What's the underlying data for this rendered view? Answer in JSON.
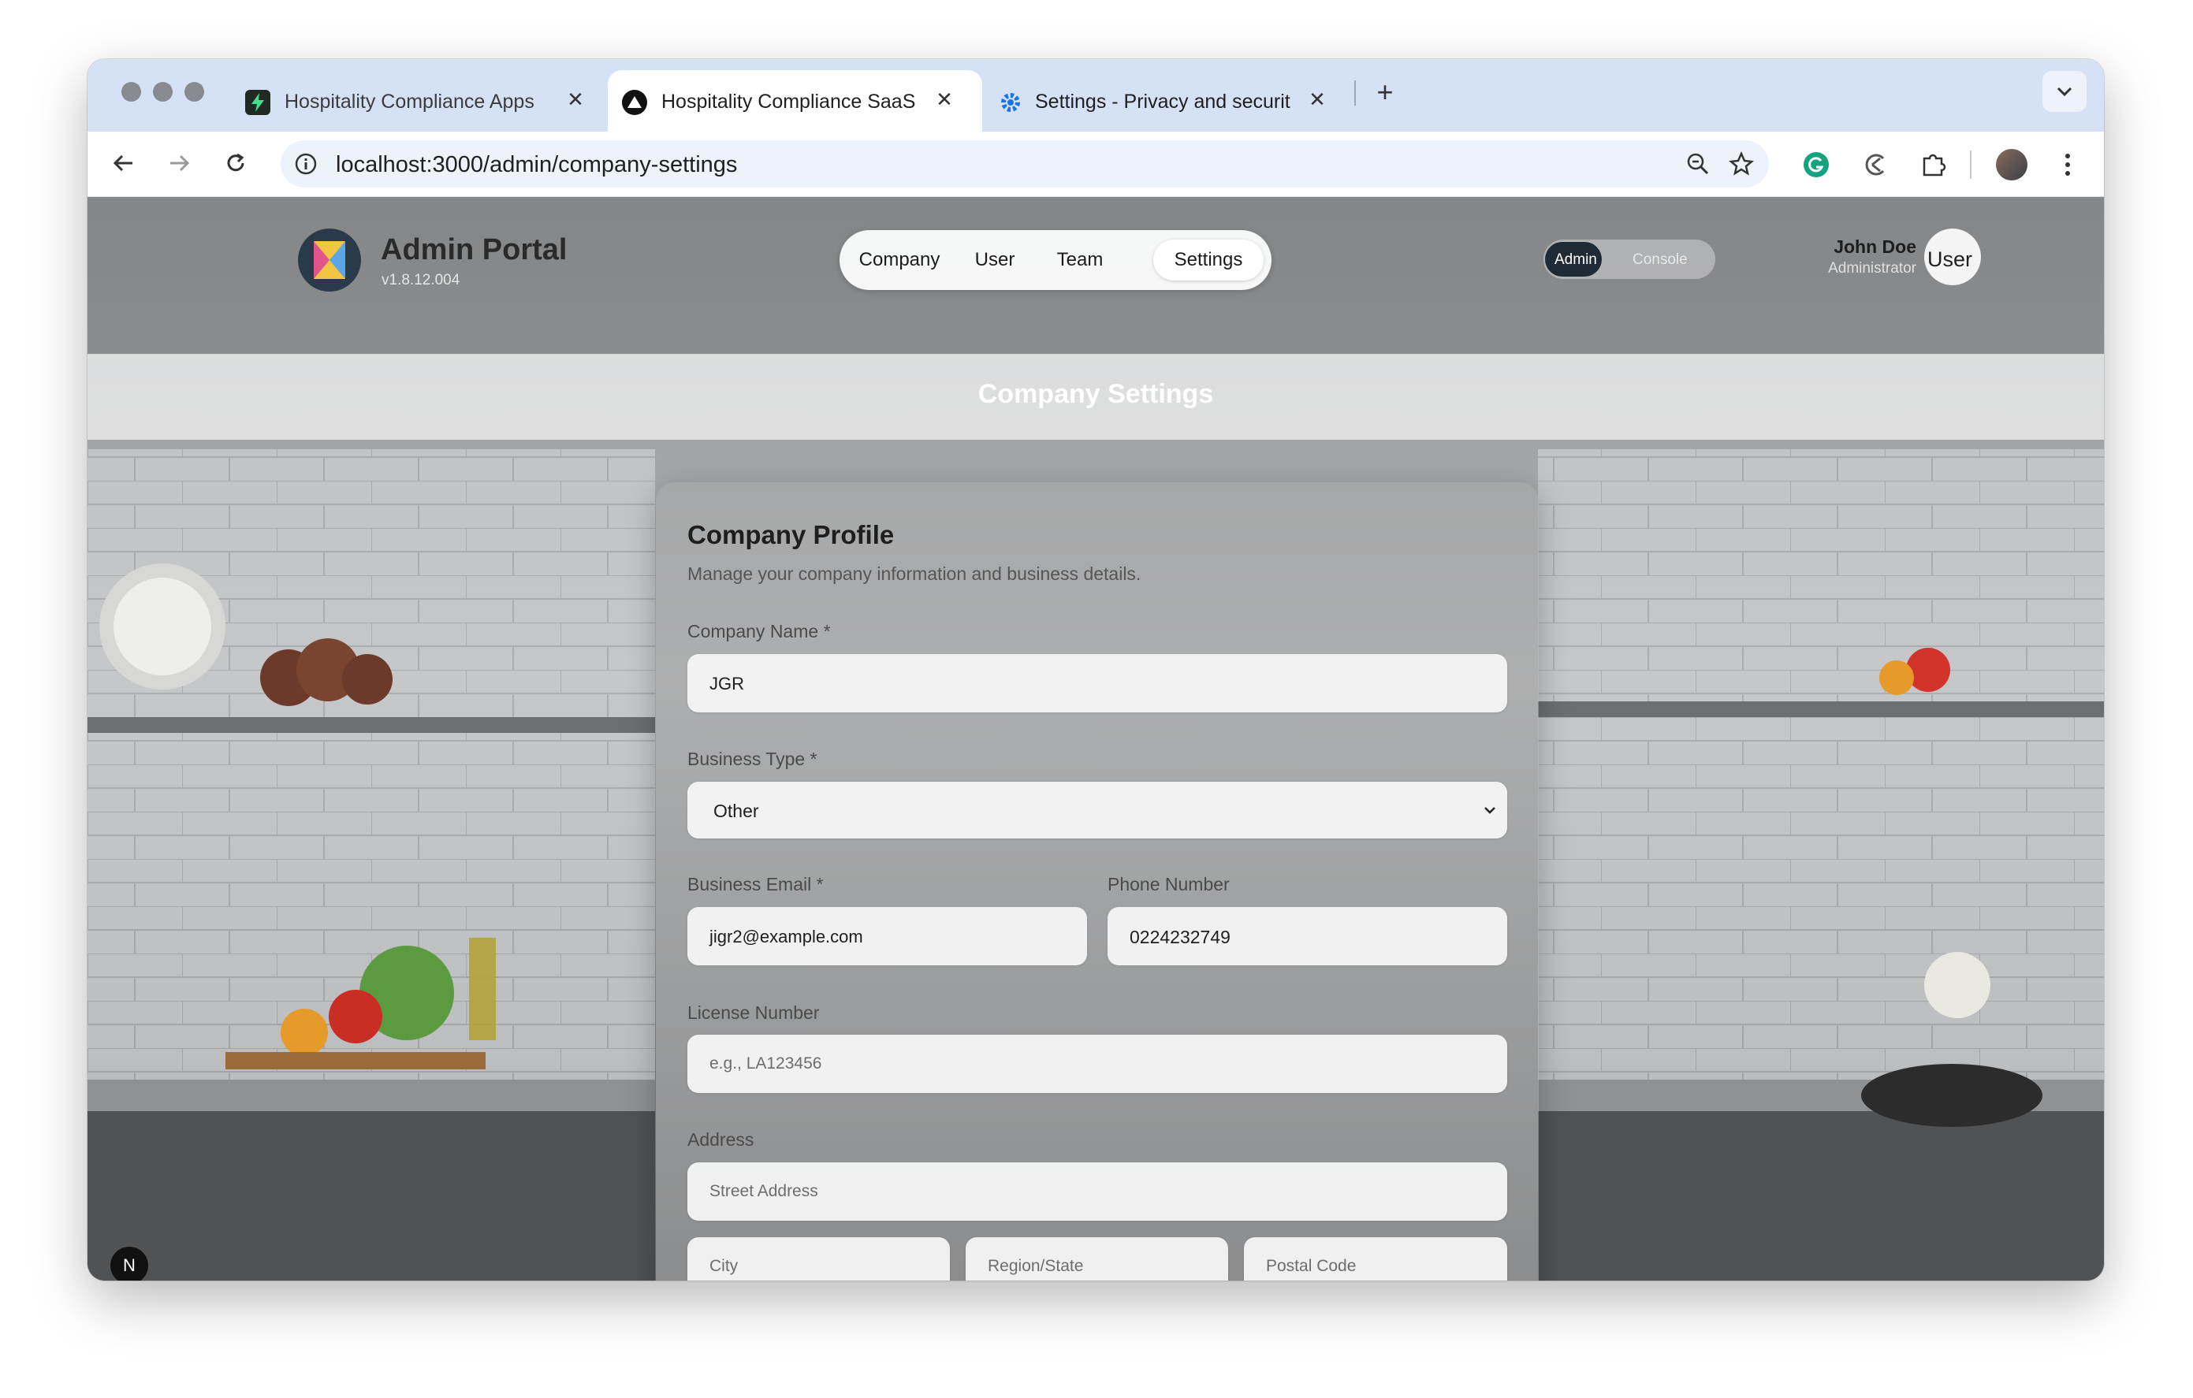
{
  "browser": {
    "tabs": [
      {
        "title": "Hospitality Compliance Apps",
        "icon": "bolt-app-icon",
        "active": false
      },
      {
        "title": "Hospitality Compliance SaaS",
        "icon": "triangle-app-icon",
        "active": true
      },
      {
        "title": "Settings - Privacy and securit",
        "icon": "gear-icon",
        "active": false
      }
    ],
    "new_tab_label": "+",
    "url": "localhost:3000/admin/company-settings"
  },
  "app": {
    "brand_title": "Admin Portal",
    "version": "v1.8.12.004",
    "nav": [
      {
        "label": "Company",
        "active": false
      },
      {
        "label": "User",
        "active": false
      },
      {
        "label": "Team",
        "active": false
      },
      {
        "label": "Settings",
        "active": true
      }
    ],
    "mode_toggle": {
      "left": "Admin",
      "right": "Console",
      "selected": "Admin"
    },
    "user": {
      "name": "John Doe",
      "role": "Administrator",
      "avatar_alt": "User"
    },
    "page_title": "Company Settings",
    "dev_badge": "N"
  },
  "form": {
    "title": "Company Profile",
    "subtitle": "Manage your company information and business details.",
    "company_name": {
      "label": "Company Name *",
      "value": "JGR"
    },
    "business_type": {
      "label": "Business Type *",
      "value": "Other"
    },
    "business_email": {
      "label": "Business Email *",
      "value": "jigr2@example.com"
    },
    "phone_number": {
      "label": "Phone Number",
      "value": "0224232749"
    },
    "license_number": {
      "label": "License Number",
      "placeholder": "e.g., LA123456"
    },
    "address": {
      "label": "Address",
      "street_placeholder": "Street Address",
      "city_placeholder": "City",
      "region_placeholder": "Region/State",
      "postal_placeholder": "Postal Code"
    }
  }
}
